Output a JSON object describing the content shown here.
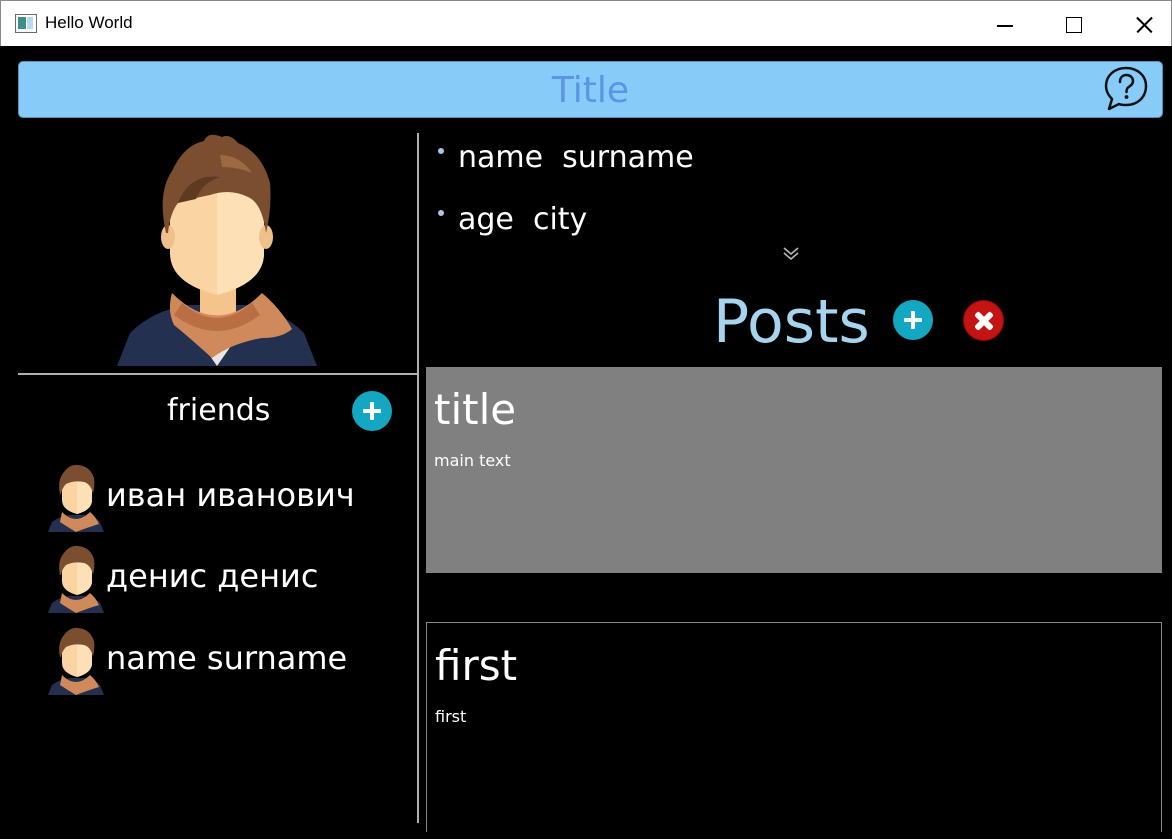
{
  "window": {
    "title": "Hello World",
    "icon": "app-window-icon"
  },
  "header": {
    "title": "Title",
    "help_icon": "help-chat-icon",
    "bar_color": "#87cbf8",
    "title_color": "#5b95e6"
  },
  "profile": {
    "avatar": "user-avatar-illustration",
    "info": [
      {
        "text": "name  surname"
      },
      {
        "text": "age  city"
      }
    ],
    "expand_icon": "chevron-double-down-icon"
  },
  "friends": {
    "label": "friends",
    "add_icon": "plus-icon",
    "items": [
      {
        "name": "иван иванович"
      },
      {
        "name": "денис денис"
      },
      {
        "name": "name surname"
      }
    ]
  },
  "posts": {
    "label": "Posts",
    "add_icon": "plus-icon",
    "remove_icon": "close-x-icon",
    "accent_add": "#14a7c1",
    "accent_remove": "#c41313",
    "items": [
      {
        "title": "title",
        "text": "main text",
        "background": "#808080"
      },
      {
        "title": "first",
        "text": "first",
        "background": "#000000"
      }
    ]
  }
}
